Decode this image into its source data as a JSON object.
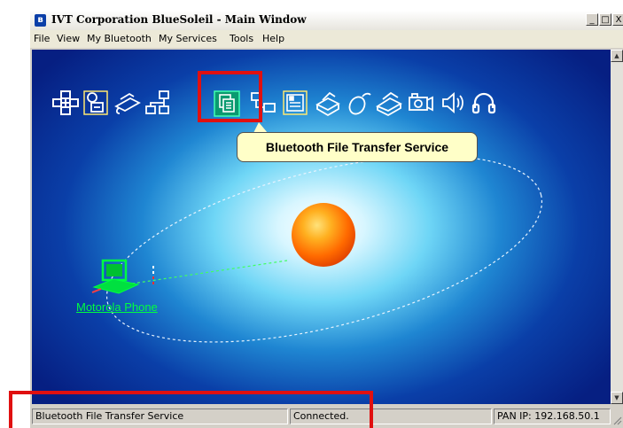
{
  "window": {
    "title": "IVT Corporation BlueSoleil - Main Window",
    "title_icon": "bluetooth-icon",
    "controls": [
      "_",
      "□",
      "X"
    ]
  },
  "menu": {
    "items": [
      "File",
      "View",
      "My Bluetooth",
      "My Services",
      "Tools",
      "Help"
    ]
  },
  "services": {
    "icons": [
      "network-access-icon",
      "dialup-networking-icon",
      "fax-icon",
      "lan-access-icon",
      "file-transfer-icon",
      "personal-area-network-icon",
      "object-push-icon",
      "printer-icon",
      "mouse-hid-icon",
      "basic-imaging-icon",
      "camera-icon",
      "audio-gateway-icon",
      "headset-icon"
    ],
    "highlighted": "file-transfer-icon",
    "tooltip": "Bluetooth File Transfer Service"
  },
  "device": {
    "label": "Motorola Phone",
    "icon": "computer-icon"
  },
  "status": {
    "service": "Bluetooth File Transfer Service",
    "connection": "Connected.",
    "pan_ip": "PAN IP: 192.168.50.1"
  },
  "colors": {
    "highlight": "#e01010",
    "tooltip_bg": "#ffffc8",
    "device_green": "#00ff40",
    "background_dark": "#061f82"
  }
}
